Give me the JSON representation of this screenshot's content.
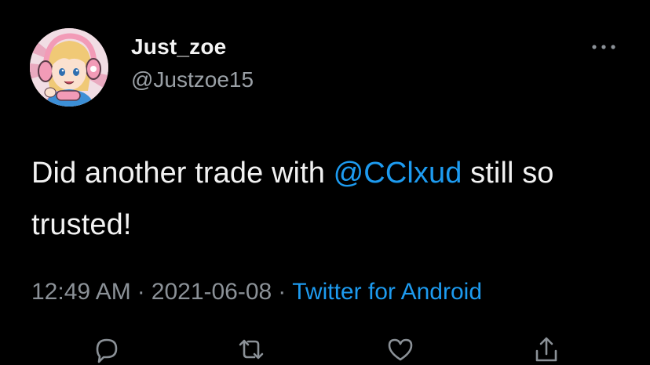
{
  "tweet": {
    "display_name": "Just_zoe",
    "handle": "@Justzoe15",
    "text_before": "Did another trade with ",
    "mention": "@CClxud",
    "text_after": " still so trusted!",
    "time": "12:49 AM",
    "separator": "·",
    "date": "2021-06-08",
    "source": "Twitter for Android"
  },
  "icons": {
    "more": "more-horizontal-icon",
    "reply": "reply-icon",
    "retweet": "retweet-icon",
    "like": "heart-icon",
    "share": "share-icon"
  },
  "colors": {
    "background": "#000000",
    "link": "#1d9bf0",
    "secondary_text": "#8b9197",
    "primary_text": "#f2f2f2"
  }
}
